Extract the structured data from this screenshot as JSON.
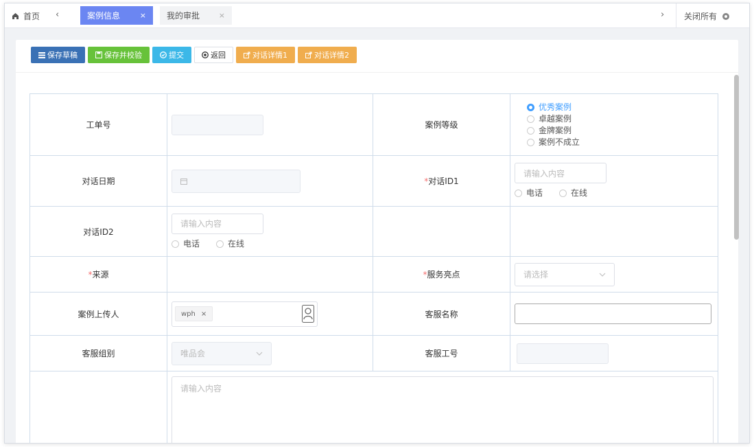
{
  "tabbar": {
    "home": "首页",
    "tabs": [
      {
        "label": "案例信息"
      },
      {
        "label": "我的审批"
      }
    ],
    "close_all": "关闭所有",
    "close_glyph": "×",
    "nav_left": "‹",
    "nav_right": "›"
  },
  "toolbar": {
    "save_draft": "保存草稿",
    "save_validate": "保存并校验",
    "submit": "提交",
    "back": "返回",
    "dialog1": "对话详情1",
    "dialog2": "对话详情2"
  },
  "form": {
    "order_no": {
      "label": "工单号",
      "value": ""
    },
    "case_level": {
      "label": "案例等级",
      "options": [
        "优秀案例",
        "卓越案例",
        "金牌案例",
        "案例不成立"
      ],
      "selected": "优秀案例"
    },
    "dialog_date": {
      "label": "对话日期",
      "value": ""
    },
    "dialog_id1": {
      "required": "*",
      "label": "对话ID1",
      "placeholder": "请输入内容",
      "options": [
        "电话",
        "在线"
      ]
    },
    "dialog_id2": {
      "label": "对话ID2",
      "placeholder": "请输入内容",
      "options": [
        "电话",
        "在线"
      ]
    },
    "source": {
      "required": "*",
      "label": "来源"
    },
    "service_highlight": {
      "required": "*",
      "label": "服务亮点",
      "placeholder": "请选择"
    },
    "uploader": {
      "label": "案例上传人",
      "tag": "wph"
    },
    "agent_name": {
      "label": "客服名称",
      "value": ""
    },
    "agent_group": {
      "label": "客服组别",
      "value": "唯品会"
    },
    "agent_no": {
      "label": "客服工号",
      "value": ""
    },
    "content": {
      "placeholder": "请输入内容"
    }
  },
  "colors": {
    "active_tab": "#6b86f2",
    "primary": "#409eff",
    "btn_blue": "#3a71b5",
    "btn_green": "#67c23a",
    "btn_cyan": "#3cb8e8",
    "btn_orange": "#f0ad4e",
    "required": "#f56c6c"
  }
}
